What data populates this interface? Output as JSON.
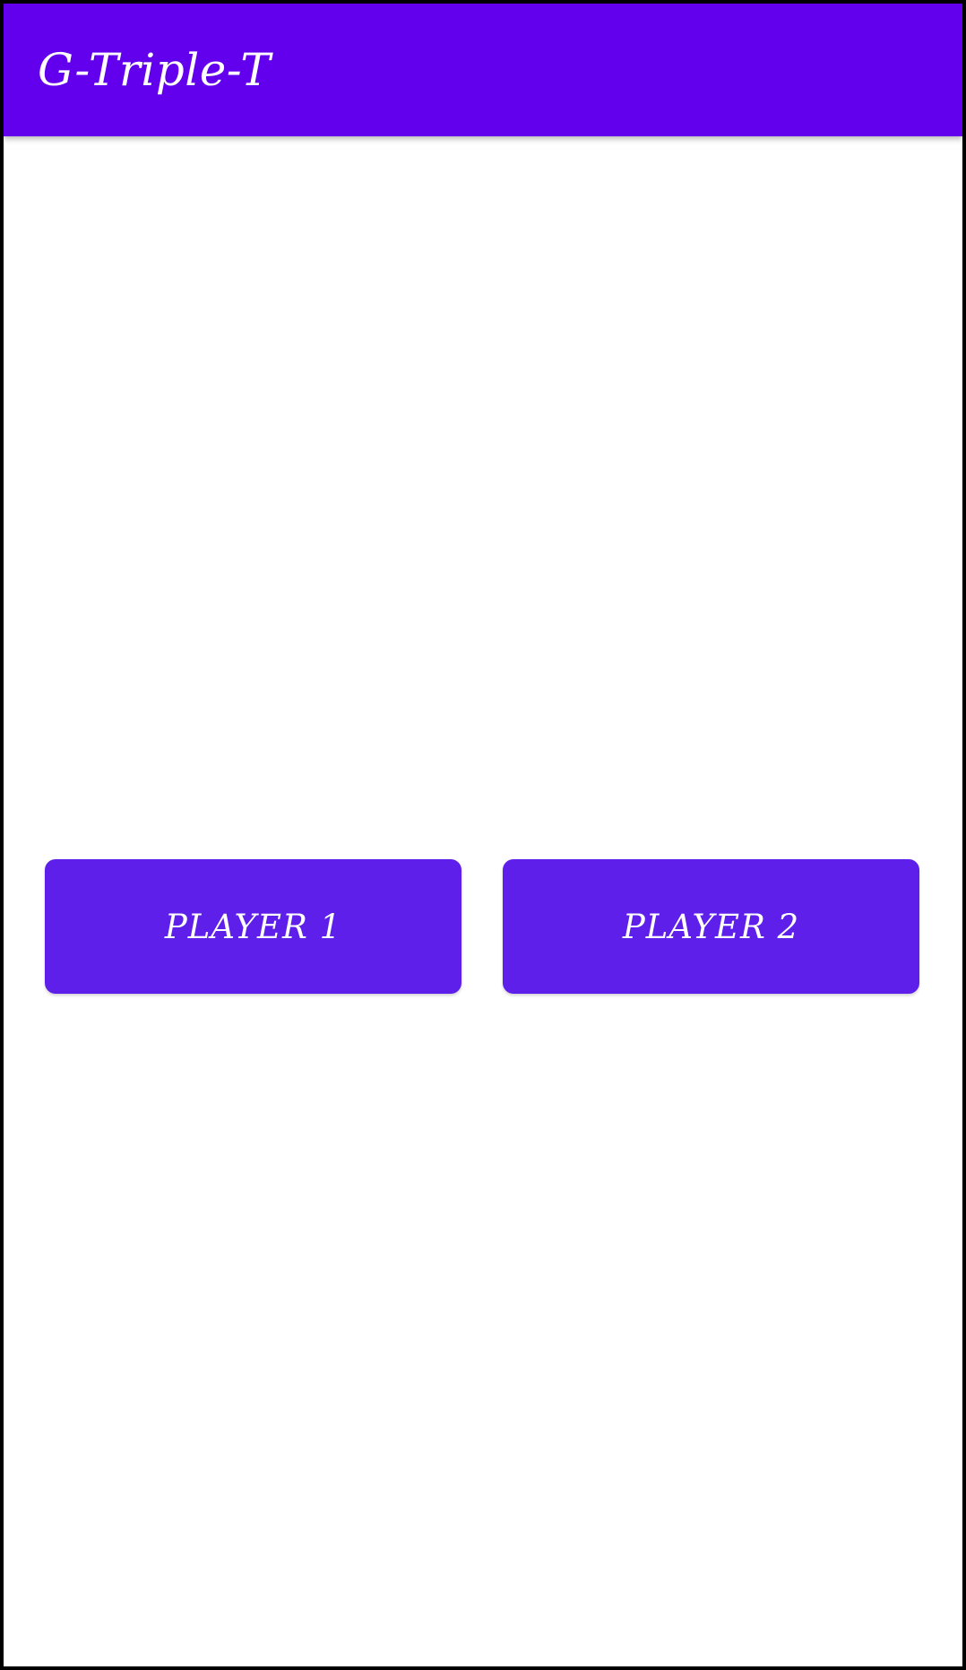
{
  "app_bar": {
    "title": "G-Triple-T"
  },
  "buttons": {
    "player1_label": "PLAYER 1",
    "player2_label": "PLAYER 2"
  },
  "colors": {
    "app_bar": "#6200ee",
    "button": "#5f1fea",
    "text": "#ffffff",
    "background": "#ffffff"
  }
}
